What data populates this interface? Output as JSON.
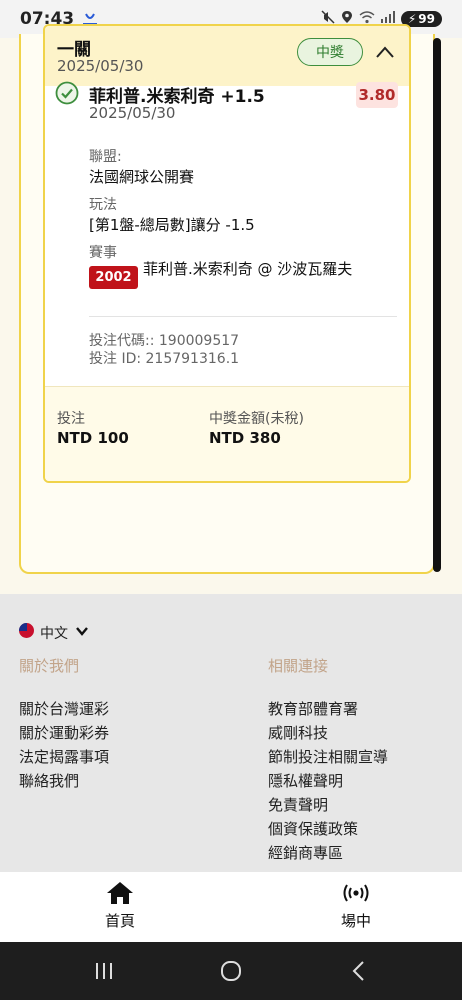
{
  "status_bar": {
    "time": "07:43",
    "battery": "99"
  },
  "bet": {
    "type_label": "一關",
    "date": "2025/05/30",
    "status": "中獎",
    "selection": {
      "name": "菲利普.米索利奇 +1.5",
      "date": "2025/05/30",
      "odds": "3.80",
      "league_label": "聯盟:",
      "league": "法國網球公開賽",
      "play_label": "玩法",
      "play": "[第1盤-總局數]讓分 -1.5",
      "event_label": "賽事",
      "event_code": "2002",
      "event_name": "菲利普.米索利奇 @ 沙波瓦羅夫"
    },
    "bet_code": "投注代碼:: 190009517",
    "bet_id": "投注 ID: 215791316.1",
    "stake_label": "投注",
    "stake": "NTD 100",
    "payout_label": "中獎金額(未稅)",
    "payout": "NTD 380"
  },
  "footer": {
    "language": "中文",
    "about_heading": "關於我們",
    "about_links": [
      "關於台灣運彩",
      "關於運動彩券",
      "法定揭露事項",
      "聯絡我們"
    ],
    "related_heading": "相關連接",
    "related_links": [
      "教育部體育署",
      "威剛科技",
      "節制投注相關宣導",
      "隱私權聲明",
      "免責聲明",
      "個資保護政策",
      "經銷商專區"
    ]
  },
  "bottom_nav": {
    "home": "首頁",
    "live": "場中"
  },
  "colors": {
    "gold_border": "#f0d34a",
    "win_green": "#3e8e3e",
    "odds_red": "#b02a2a",
    "event_red": "#c0131a"
  }
}
